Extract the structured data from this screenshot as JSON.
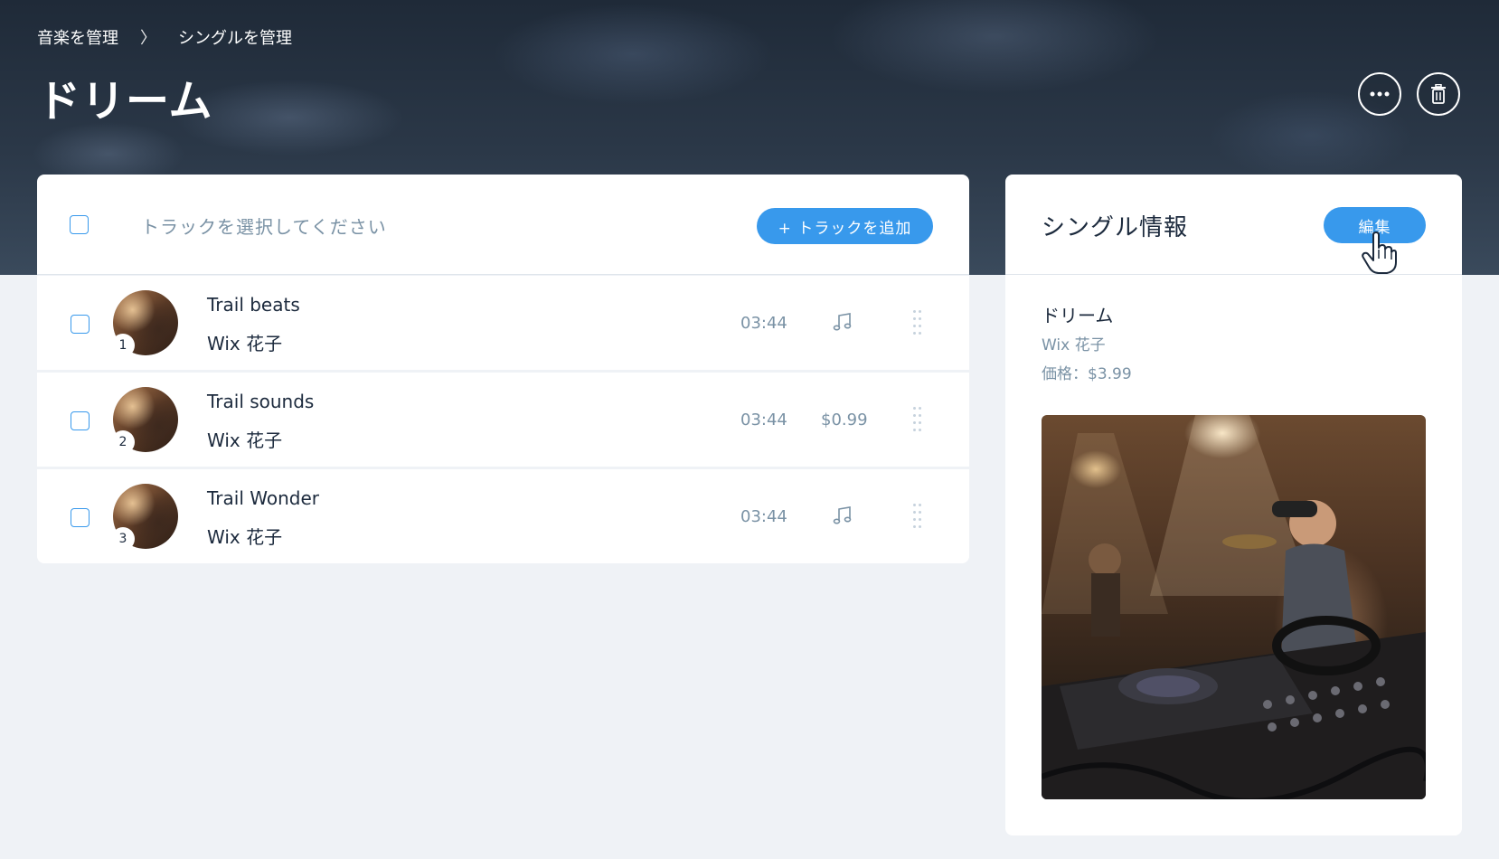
{
  "breadcrumb": {
    "items": [
      "音楽を管理",
      "シングルを管理"
    ],
    "separator": "〉"
  },
  "page": {
    "title": "ドリーム"
  },
  "header_actions": {
    "more_icon": "more-horizontal-icon",
    "delete_icon": "trash-icon"
  },
  "tracks": {
    "select_label": "トラックを選択してください",
    "add_button": "+ トラックを追加",
    "items": [
      {
        "number": "1",
        "title": "Trail beats",
        "artist": "Wix 花子",
        "duration": "03:44",
        "price": "",
        "price_icon": "music-note-icon"
      },
      {
        "number": "2",
        "title": "Trail sounds",
        "artist": "Wix 花子",
        "duration": "03:44",
        "price": "$0.99",
        "price_icon": ""
      },
      {
        "number": "3",
        "title": "Trail Wonder",
        "artist": "Wix 花子",
        "duration": "03:44",
        "price": "",
        "price_icon": "music-note-icon"
      }
    ]
  },
  "single_info": {
    "heading": "シングル情報",
    "edit_button": "編集",
    "name": "ドリーム",
    "artist": "Wix 花子",
    "price": "価格：$3.99"
  },
  "colors": {
    "accent": "#3899ec",
    "page_bg": "#eff2f6",
    "muted_text": "#7a92a5"
  }
}
